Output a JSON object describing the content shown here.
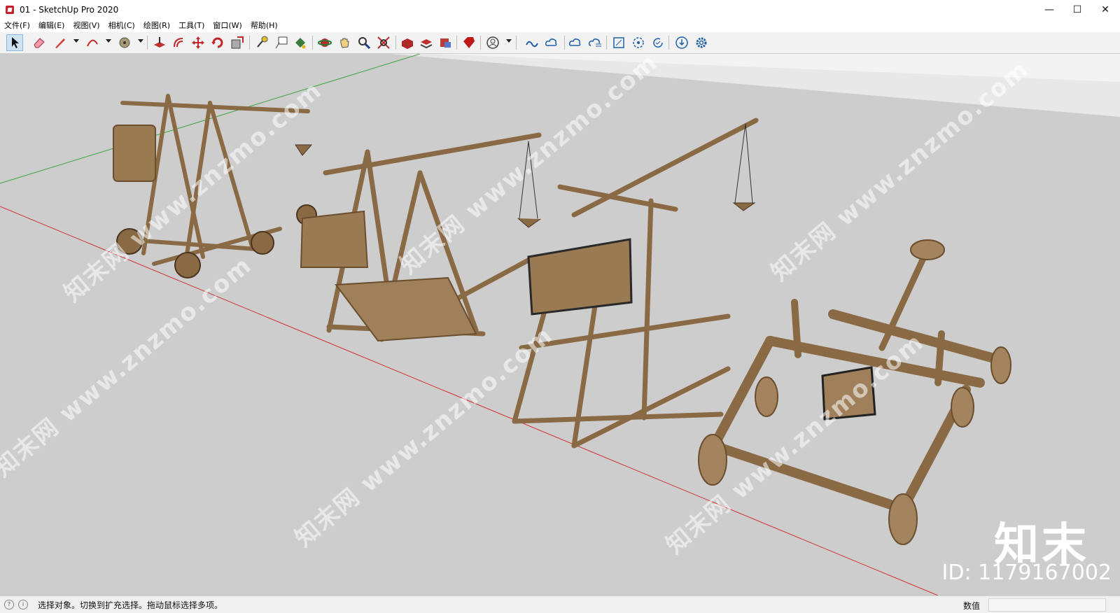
{
  "window": {
    "title": "01 - SketchUp Pro 2020",
    "minimize": "—",
    "maximize": "☐",
    "close": "✕"
  },
  "menubar": {
    "items": [
      "文件(F)",
      "编辑(E)",
      "视图(V)",
      "相机(C)",
      "绘图(R)",
      "工具(T)",
      "窗口(W)",
      "帮助(H)"
    ]
  },
  "toolbar": {
    "tools": [
      "select-tool",
      "eraser-tool",
      "line-tool",
      "arc-tool",
      "shape-tool",
      "push-pull-tool",
      "offset-tool",
      "move-tool",
      "rotate-tool",
      "scale-tool",
      "tape-measure-tool",
      "text-tool",
      "paint-bucket-tool",
      "orbit-tool",
      "pan-tool",
      "zoom-tool",
      "zoom-extents-tool",
      "warehouse-tool",
      "extension-warehouse-tool",
      "layout-tool",
      "extension-manager-tool",
      "profile-tool",
      "trimble-connect-tool",
      "share-tool",
      "cloud-upload-tool",
      "cloud-open-tool",
      "model-info-tool",
      "components-tool",
      "reload-tool",
      "download-tool",
      "settings-tool"
    ]
  },
  "viewport": {
    "background": "#cdcdcd",
    "watermark_text": "知末网 www.znzmo.com",
    "brand": "知末",
    "asset_id": "ID: 1179167002"
  },
  "statusbar": {
    "message": "选择对象。切换到扩充选择。拖动鼠标选择多项。",
    "measurements_label": "数值",
    "measurements_value": ""
  }
}
